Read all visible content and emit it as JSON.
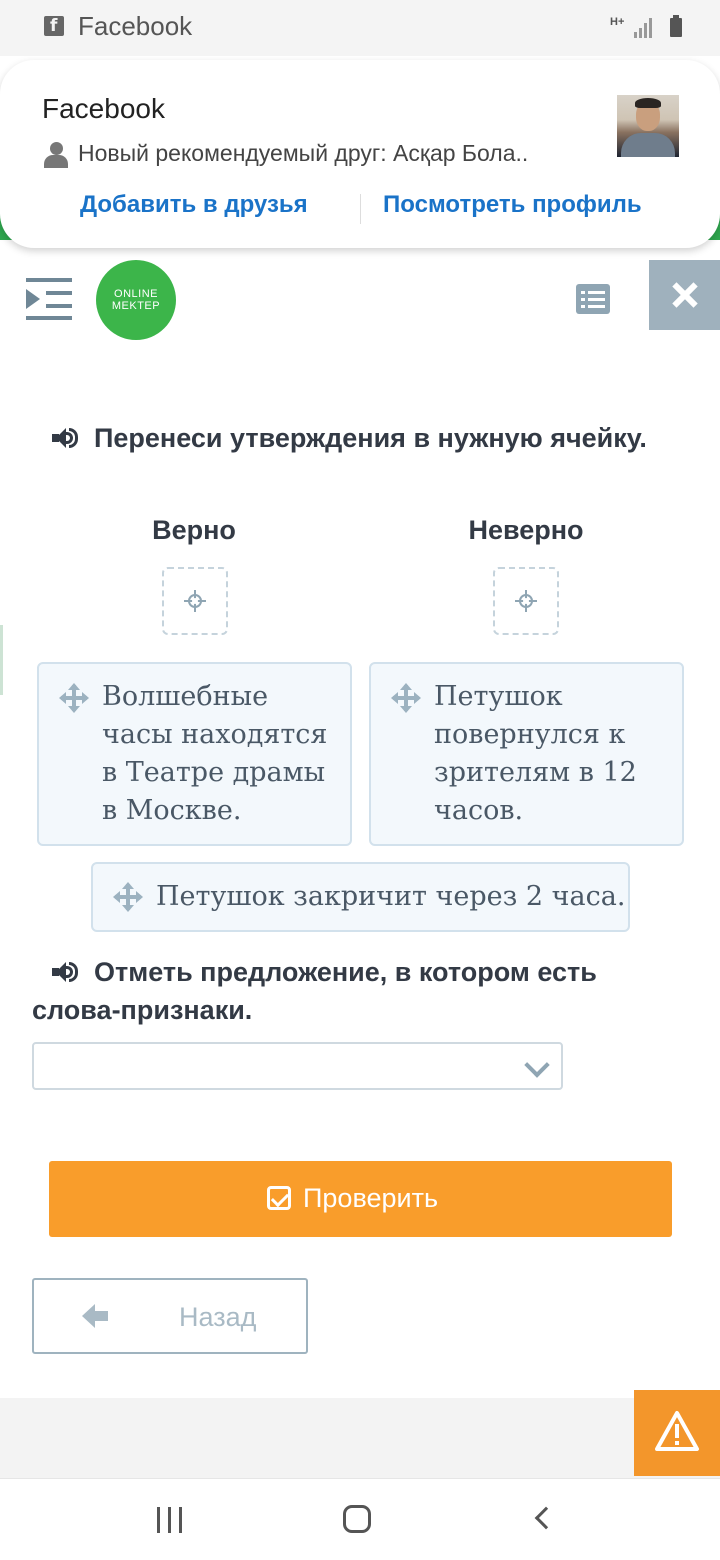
{
  "status_bar": {
    "app_name": "Facebook",
    "network_label": "H+"
  },
  "notification": {
    "app_name": "Facebook",
    "text": "Новый рекомендуемый друг: Асқар Бола..",
    "add_friend_label": "Добавить в друзья",
    "view_profile_label": "Посмотреть профиль"
  },
  "header": {
    "logo_line1": "ONLINE",
    "logo_line2": "MEKTEP"
  },
  "task1": {
    "prompt": "Перенеси утверждения в нужную ячейку.",
    "columns": [
      "Верно",
      "Неверно"
    ],
    "cards": [
      "Волшебные часы находятся в Театре драмы в Москве.",
      "Петушок повернулся к зрителям в 12 часов.",
      "Петушок закричит через 2 часа."
    ]
  },
  "task2": {
    "prompt": "Отметь предложение, в котором есть слова-признаки.",
    "selected_value": ""
  },
  "buttons": {
    "check_label": "Проверить",
    "back_label": "Назад"
  },
  "colors": {
    "accent_orange": "#f99d2b",
    "logo_green": "#3cb54a",
    "link_blue": "#1a73c8",
    "card_bg": "#f3f8fc"
  }
}
